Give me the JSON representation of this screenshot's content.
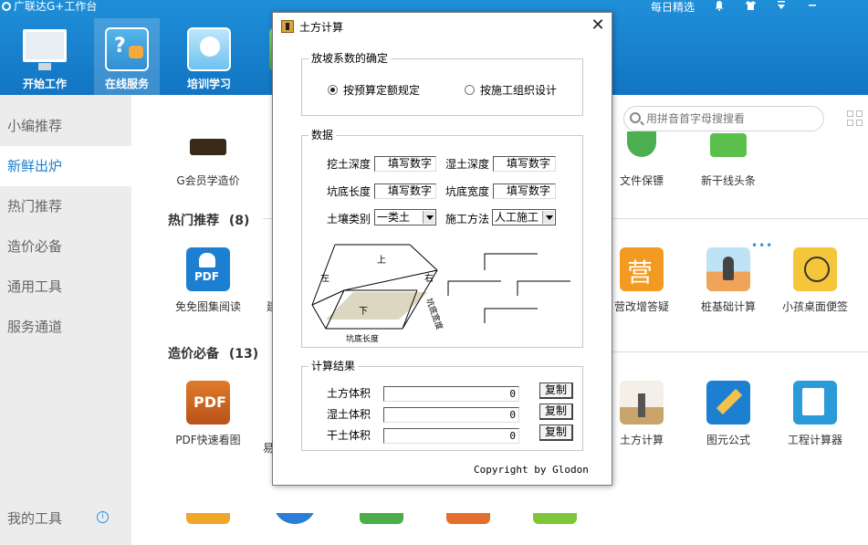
{
  "app": {
    "title": "广联达G+工作台"
  },
  "topbar": {
    "daily": "每日精选",
    "tabs": [
      {
        "label": "开始工作"
      },
      {
        "label": "在线服务"
      },
      {
        "label": "培训学习"
      }
    ]
  },
  "sidebar": {
    "items": [
      {
        "label": "小编推荐"
      },
      {
        "label": "新鲜出炉"
      },
      {
        "label": "热门推荐"
      },
      {
        "label": "造价必备"
      },
      {
        "label": "通用工具"
      },
      {
        "label": "服务通道"
      }
    ],
    "my_tools": "我的工具",
    "info_icon": "i"
  },
  "search": {
    "placeholder": "用拼音首字母搜搜看"
  },
  "sections": {
    "hot": {
      "title": "热门推荐",
      "count": "(8)"
    },
    "cost": {
      "title": "造价必备",
      "count": "(13)"
    }
  },
  "apps": {
    "gmember": "G会员学造价",
    "file_protect": "文件保镖",
    "news": "新干线头条",
    "pdf_free": "免免图集阅读",
    "yinggai": "营改增答疑",
    "pile": "桩基础计算",
    "kid_note": "小孩桌面便签",
    "pdf_fast": "PDF快速看图",
    "earthwork": "土方计算",
    "tuyuan": "图元公式",
    "calc": "工程计算器",
    "partial_hot": "建",
    "partial_cost": "易"
  },
  "dialog": {
    "title": "土方计算",
    "slope_group": {
      "label": "放坡系数的确定",
      "option1": "按预算定额规定",
      "option2": "按施工组织设计",
      "selected": "option1"
    },
    "data_group": {
      "label": "数据",
      "dig_depth": {
        "label": "挖土深度",
        "placeholder": "填写数字"
      },
      "wet_depth": {
        "label": "湿土深度",
        "placeholder": "填写数字"
      },
      "pit_length": {
        "label": "坑底长度",
        "placeholder": "填写数字"
      },
      "pit_width": {
        "label": "坑底宽度",
        "placeholder": "填写数字"
      },
      "soil_type": {
        "label": "土壤类别",
        "value": "一类土"
      },
      "method": {
        "label": "施工方法",
        "value": "人工施工"
      },
      "diagram": {
        "top": "上",
        "left": "左",
        "right": "右",
        "bottom": "下",
        "pit_width_label": "坑底宽度",
        "pit_length_label": "坑底长度"
      }
    },
    "result_group": {
      "label": "计算结果",
      "rows": [
        {
          "label": "土方体积",
          "value": "0",
          "button": "复制"
        },
        {
          "label": "湿土体积",
          "value": "0",
          "button": "复制"
        },
        {
          "label": "干土体积",
          "value": "0",
          "button": "复制"
        }
      ]
    },
    "copyright": "Copyright by Glodon"
  }
}
